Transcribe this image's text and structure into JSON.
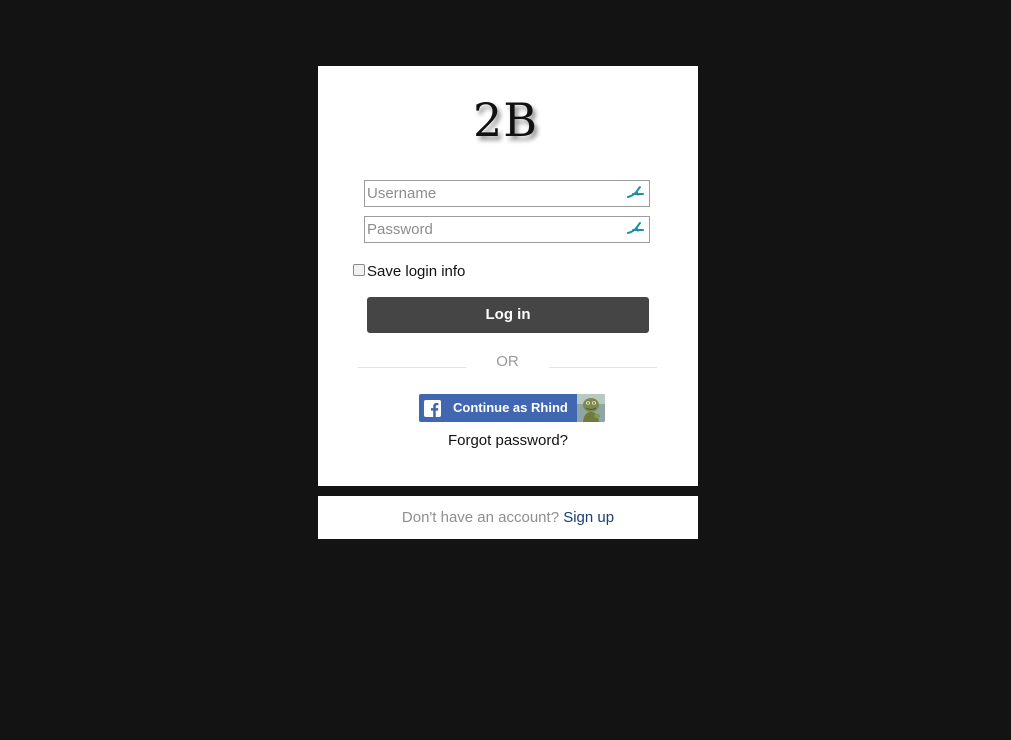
{
  "logo": {
    "text": "2B"
  },
  "login_form": {
    "username_placeholder": "Username",
    "username_value": "",
    "password_placeholder": "Password",
    "password_value": "",
    "field_icon": "key-icon",
    "remember_label": "Save login info",
    "remember_checked": false,
    "login_button_label": "Log in"
  },
  "divider": {
    "text": "OR"
  },
  "facebook": {
    "button_label": "Continue as Rhind",
    "logo_icon": "facebook-logo-icon",
    "avatar": "user-avatar",
    "brand_color": "#4267b2"
  },
  "links": {
    "forgot_password": "Forgot password?"
  },
  "signup": {
    "prompt": "Don't have an account?",
    "link_label": "Sign up"
  },
  "colors": {
    "background": "#131313",
    "card": "#ffffff",
    "button": "#454545",
    "signup_link": "#1b3d73",
    "key_icon": "#1e8fa3"
  }
}
